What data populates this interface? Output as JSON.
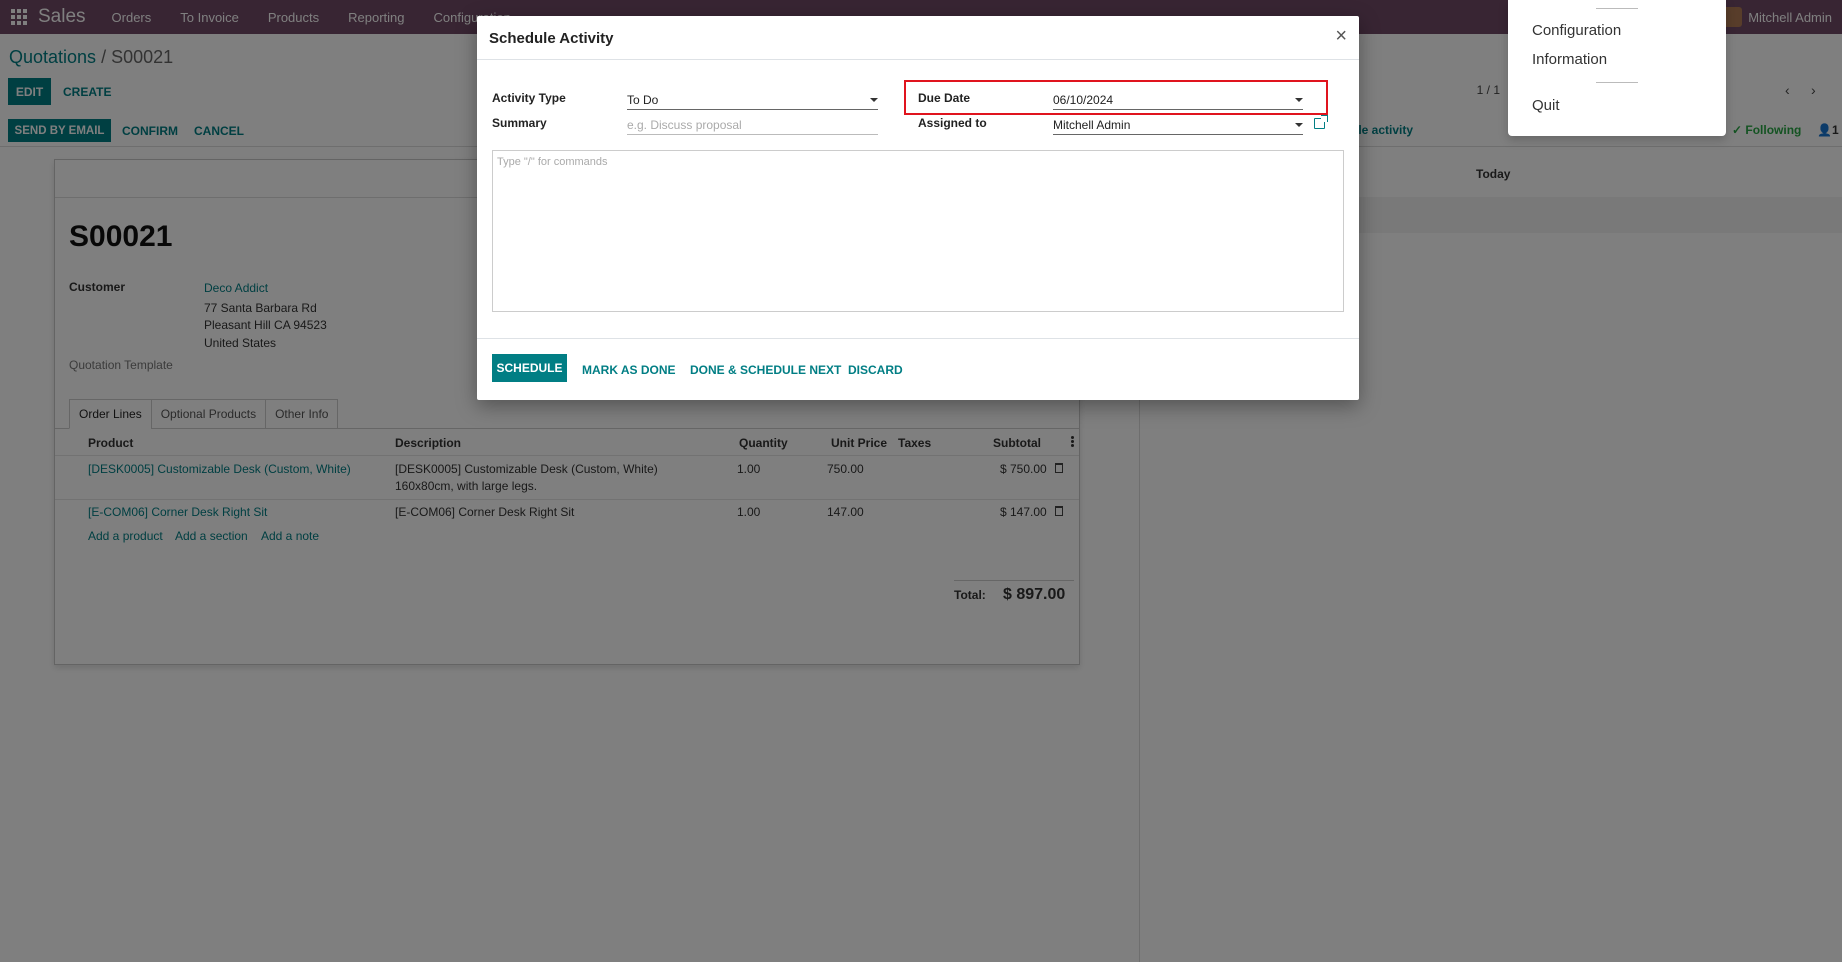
{
  "navbar": {
    "brand": "Sales",
    "menus": [
      "Orders",
      "To Invoice",
      "Products",
      "Reporting",
      "Configuration"
    ],
    "user": "Mitchell Admin"
  },
  "breadcrumb": {
    "parent": "Quotations",
    "separator": "/",
    "current": "S00021"
  },
  "buttons": {
    "edit": "EDIT",
    "create": "CREATE",
    "send_email": "SEND BY EMAIL",
    "confirm": "CONFIRM",
    "cancel": "CANCEL"
  },
  "pager": "1 / 1",
  "form": {
    "name": "S00021",
    "customer_label": "Customer",
    "customer_name": "Deco Addict",
    "address": [
      "77 Santa Barbara Rd",
      "Pleasant Hill CA 94523",
      "United States"
    ],
    "quotation_template_label": "Quotation Template",
    "tabs": [
      "Order Lines",
      "Optional Products",
      "Other Info"
    ],
    "columns": [
      "Product",
      "Description",
      "Quantity",
      "Unit Price",
      "Taxes",
      "Subtotal"
    ],
    "lines": [
      {
        "product": "[DESK0005] Customizable Desk (Custom, White)",
        "description": [
          "[DESK0005] Customizable Desk (Custom, White)",
          "160x80cm, with large legs."
        ],
        "quantity": "1.00",
        "unit_price": "750.00",
        "subtotal": "$ 750.00"
      },
      {
        "product": "[E-COM06] Corner Desk Right Sit",
        "description": [
          "[E-COM06] Corner Desk Right Sit"
        ],
        "quantity": "1.00",
        "unit_price": "147.00",
        "subtotal": "$ 147.00"
      }
    ],
    "add_product": "Add a product",
    "add_section": "Add a section",
    "add_note": "Add a note",
    "total_label": "Total:",
    "total_value": "$ 897.00"
  },
  "chatter": {
    "schedule_activity": "ule activity",
    "following": "Following",
    "followers": "1",
    "today": "Today"
  },
  "user_menu": {
    "items": [
      "Configuration",
      "Information",
      "Quit"
    ]
  },
  "modal": {
    "title": "Schedule Activity",
    "close": "×",
    "activity_type_label": "Activity Type",
    "activity_type_value": "To Do",
    "summary_label": "Summary",
    "summary_placeholder": "e.g. Discuss proposal",
    "due_date_label": "Due Date",
    "due_date_value": "06/10/2024",
    "assigned_label": "Assigned to",
    "assigned_value": "Mitchell Admin",
    "note_placeholder": "Type \"/\" for commands",
    "buttons": {
      "schedule": "SCHEDULE",
      "mark_done": "MARK AS DONE",
      "done_next": "DONE & SCHEDULE NEXT",
      "discard": "DISCARD"
    }
  },
  "colors": {
    "navbar": "#714b67",
    "primary": "#017e84",
    "highlight": "#e0141e"
  }
}
